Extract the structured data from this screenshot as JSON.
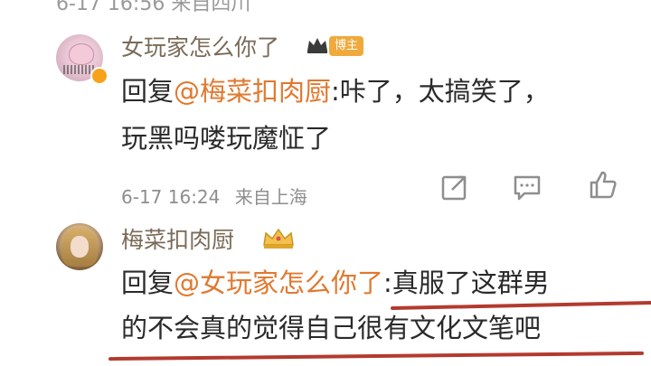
{
  "top_clip": {
    "text": "6-17 16:56 来自四川"
  },
  "comments": [
    {
      "username": "女玩家怎么你了",
      "badge": "博主",
      "reply_prefix": "回复",
      "mention": "@梅菜扣肉厨",
      "line1_rest": ":咔了，太搞笑了，",
      "line2": "玩黑吗喽玩魔怔了",
      "timestamp": "6-17 16:24",
      "location": "来自上海"
    },
    {
      "username": "梅菜扣肉厨",
      "reply_prefix": "回复",
      "mention": "@女玩家怎么你了",
      "line1_rest": ":真服了这群男",
      "line2": "的不会真的觉得自己很有文化文笔吧"
    }
  ],
  "colors": {
    "mention": "#e0792f",
    "username": "#7a6b58",
    "underline": "#b33a2f",
    "badge": "#f0a93b"
  },
  "icons": [
    "share-icon",
    "comment-icon",
    "like-icon",
    "crown-icon"
  ]
}
